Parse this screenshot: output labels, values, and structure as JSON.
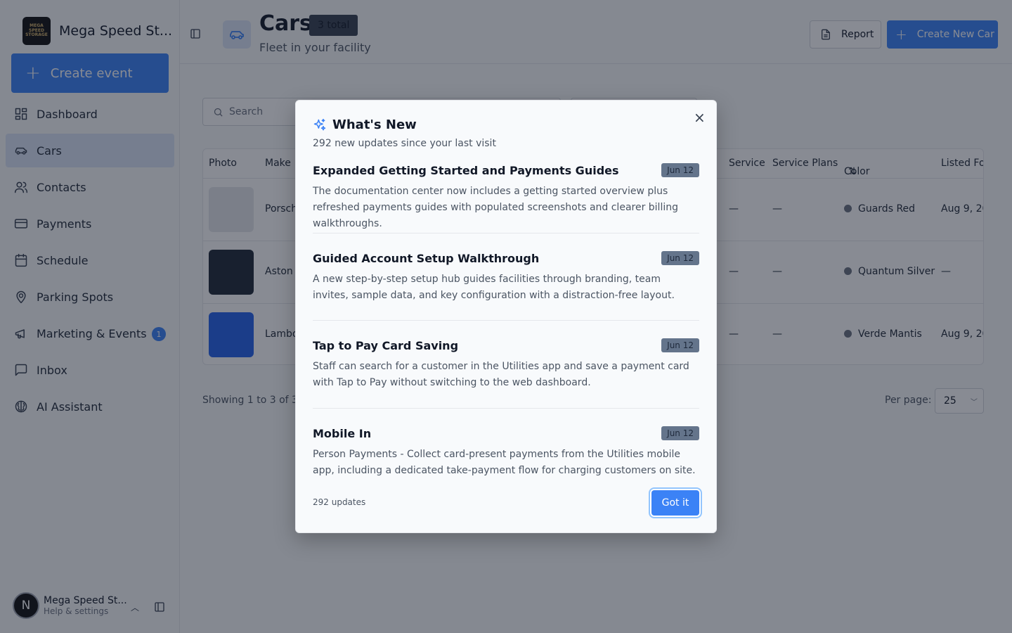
{
  "app": {
    "brand_name": "Mega Speed St...",
    "logo_text": "MEGA SPEED STORAGE",
    "create_event_label": "Create event"
  },
  "nav": {
    "items": [
      {
        "label": "Dashboard",
        "icon": "dashboard-icon"
      },
      {
        "label": "Cars",
        "icon": "car-icon",
        "active": true
      },
      {
        "label": "Contacts",
        "icon": "users-icon"
      },
      {
        "label": "Payments",
        "icon": "credit-card-icon"
      },
      {
        "label": "Schedule",
        "icon": "calendar-icon"
      },
      {
        "label": "Parking Spots",
        "icon": "map-pin-icon"
      },
      {
        "label": "Marketing & Events",
        "icon": "megaphone-icon",
        "badge": "1"
      },
      {
        "label": "Inbox",
        "icon": "message-square-icon"
      },
      {
        "label": "AI Assistant",
        "icon": "brain-icon"
      }
    ]
  },
  "profile": {
    "avatar_letter": "N",
    "name": "Mega Speed St...",
    "sub": "Help & settings"
  },
  "header": {
    "title": "Cars",
    "total_badge": "3 total",
    "subtitle": "Fleet in your facility",
    "report_label": "Report",
    "create_label": "Create New Car"
  },
  "search": {
    "placeholder": "Search"
  },
  "table": {
    "columns": [
      "Photo",
      "Make",
      "Service",
      "Service Plans",
      "Color",
      "Listed Fo"
    ],
    "rows": [
      {
        "make": "Porsch",
        "service": "—",
        "service_plans": "—",
        "color": "Guards Red",
        "listed": "Aug 9, 20",
        "photo_color": "#e5e7eb"
      },
      {
        "make": "Aston",
        "service": "—",
        "service_plans": "—",
        "color": "Quantum Silver",
        "listed": "—",
        "photo_color": "#1f2937"
      },
      {
        "make": "Lambo",
        "service": "—",
        "service_plans": "—",
        "color": "Verde Mantis",
        "listed": "Aug 9, 20",
        "photo_color": "#2563eb"
      }
    ]
  },
  "pagination": {
    "showing": "Showing 1 to 3 of 3",
    "per_page_label": "Per page:",
    "per_page_value": "25"
  },
  "modal": {
    "title": "What's New",
    "subtitle": "292 new updates since your last visit",
    "updates": [
      {
        "title": "Expanded Getting Started and Payments Guides",
        "date": "Jun 12",
        "desc": "The documentation center now includes a getting started overview plus refreshed payments guides with populated screenshots and clearer billing walkthroughs."
      },
      {
        "title": "Guided Account Setup Walkthrough",
        "date": "Jun 12",
        "desc": "A new step-by-step setup hub guides facilities through branding, team invites, sample data, and key configuration with a distraction-free layout."
      },
      {
        "title": "Tap to Pay Card Saving",
        "date": "Jun 12",
        "desc": "Staff can search for a customer in the Utilities app and save a payment card with Tap to Pay without switching to the web dashboard."
      },
      {
        "title": "Mobile In",
        "date": "Jun 12",
        "desc": "Person Payments - Collect card-present payments from the Utilities mobile app, including a dedicated take-payment flow for charging customers on site."
      }
    ],
    "footer_text": "292 updates",
    "got_it_label": "Got it",
    "close_glyph": "×"
  },
  "colors": {
    "accent": "#3b82f6",
    "active_nav": "#dbe5f6",
    "overlay": "rgba(17,24,39,0.5)"
  }
}
